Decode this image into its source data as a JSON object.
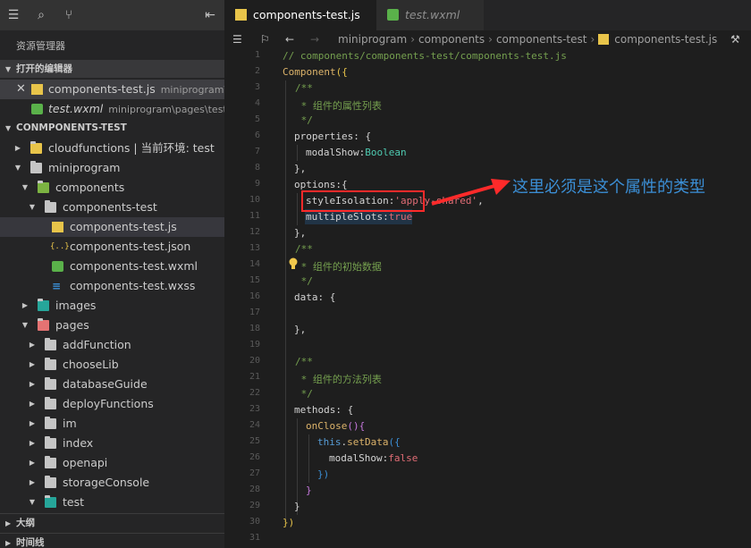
{
  "sidebar": {
    "title": "资源管理器",
    "sections": {
      "open_editors": "打开的编辑器",
      "project": "CONMPONENTS-TEST",
      "outline": "大纲",
      "timeline": "时间线"
    },
    "open_editors": [
      {
        "name": "components-test.js",
        "path": "miniprogram\\...",
        "active": true
      },
      {
        "name": "test.wxml",
        "path": "miniprogram\\pages\\test",
        "active": false
      }
    ],
    "tree": [
      {
        "label": "cloudfunctions | 当前环境: test"
      },
      {
        "label": "miniprogram"
      },
      {
        "label": "components"
      },
      {
        "label": "components-test"
      },
      {
        "label": "components-test.js"
      },
      {
        "label": "components-test.json"
      },
      {
        "label": "components-test.wxml"
      },
      {
        "label": "components-test.wxss"
      },
      {
        "label": "images"
      },
      {
        "label": "pages"
      },
      {
        "label": "addFunction"
      },
      {
        "label": "chooseLib"
      },
      {
        "label": "databaseGuide"
      },
      {
        "label": "deployFunctions"
      },
      {
        "label": "im"
      },
      {
        "label": "index"
      },
      {
        "label": "openapi"
      },
      {
        "label": "storageConsole"
      },
      {
        "label": "test"
      }
    ]
  },
  "editor": {
    "tabs": [
      {
        "label": "components-test.js",
        "active": true
      },
      {
        "label": "test.wxml",
        "active": false
      }
    ],
    "breadcrumb": [
      "miniprogram",
      "components",
      "components-test",
      "components-test.js"
    ],
    "line_numbers": [
      "1",
      "2",
      "3",
      "4",
      "5",
      "6",
      "7",
      "8",
      "9",
      "10",
      "11",
      "12",
      "13",
      "14",
      "15",
      "16",
      "17",
      "18",
      "19",
      "20",
      "21",
      "22",
      "23",
      "24",
      "25",
      "26",
      "27",
      "28",
      "29",
      "30",
      "31"
    ],
    "code": {
      "l1": "// components/components-test/components-test.js",
      "l2a": "Component",
      "l2b": "({",
      "l3": "/**",
      "l4": " * 组件的属性列表",
      "l5": " */",
      "l6a": "properties",
      "l6b": ": {",
      "l7a": "modalShow",
      "l7b": ":",
      "l7c": "Boolean",
      "l8": "},",
      "l9a": "options",
      "l9b": ":{",
      "l10a": "styleIsolation",
      "l10b": ":",
      "l10c": "'apply-shared'",
      "l10d": ",",
      "l11a": "multipleSlots",
      "l11b": ":",
      "l11c": "true",
      "l12": "},",
      "l13": "/**",
      "l14": " * 组件的初始数据",
      "l15": " */",
      "l16a": "data",
      "l16b": ": {",
      "l18": "},",
      "l20": "/**",
      "l21": " * 组件的方法列表",
      "l22": " */",
      "l23a": "methods",
      "l23b": ": {",
      "l24a": "onClose",
      "l24b": "(){",
      "l25a": "this",
      "l25b": ".",
      "l25c": "setData",
      "l25d": "({",
      "l26a": "modalShow",
      "l26b": ":",
      "l26c": "false",
      "l27": "})",
      "l28": "}",
      "l29": "}",
      "l30": "})"
    },
    "annotation": "这里必须是这个属性的类型"
  },
  "colors": {
    "annotation": "#3b8fd6",
    "highlight_box": "#ff2a2a"
  }
}
